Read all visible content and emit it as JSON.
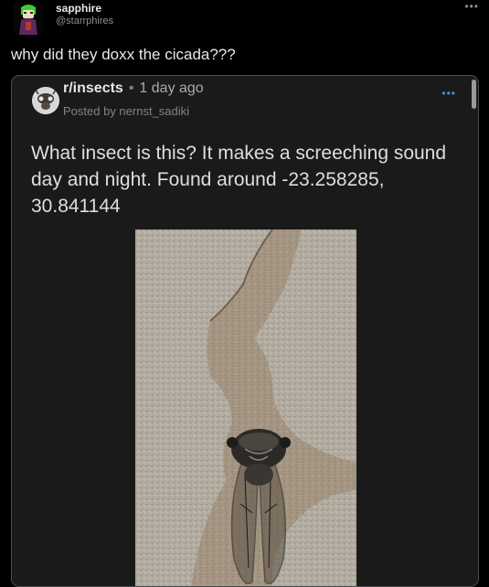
{
  "tweet": {
    "display_name": "sapphire",
    "handle": "@starrphires",
    "text": "why did they doxx the cicada???",
    "more_icon": "more-horizontal-icon"
  },
  "reddit_post": {
    "subreddit": "r/insects",
    "separator": "•",
    "time": "1 day ago",
    "posted_by": "Posted by nernst_sadiki",
    "title": "What insect is this? It makes a screeching sound day and night. Found around -23.258285, 30.841144",
    "more_icon": "more-horizontal-icon",
    "image_subject": "cicada-photo"
  }
}
